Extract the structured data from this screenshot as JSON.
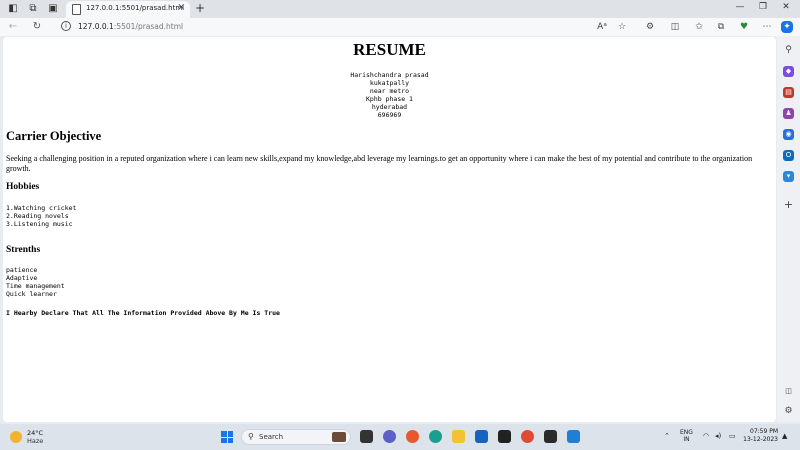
{
  "browser": {
    "tab_title": "127.0.0.1:5501/prasad.html",
    "tab_close": "✕",
    "new_tab": "+",
    "url_host": "127.0.0.1",
    "url_rest": ":5501/prasad.html",
    "window_controls": {
      "minimize": "—",
      "maximize": "❐",
      "close": "✕"
    }
  },
  "page": {
    "title": "RESUME",
    "address_lines": [
      "Harishchandra prasad",
      "kukatpally",
      "near metro",
      "Kphb phase 1",
      "hyderabad",
      "696969"
    ],
    "objective_heading": "Carrier Objective",
    "objective_text": "Seeking a challenging position in a reputed organization where i can learn new skills,expand my knowledge,abd leverage my learnings.to get an opportunity where i can make the best of my potential and contribute to the organization growth.",
    "hobbies_heading": "Hobbies",
    "hobbies": [
      "1.Watching cricket",
      "2.Reading novels",
      "3.Listening music"
    ],
    "strengths_heading": "Strenths",
    "strengths": [
      "patience",
      "Adaptive",
      "Time management",
      "Quick learner"
    ],
    "declaration": "I Hearby Declare That All The Information Provided Above By Me Is True"
  },
  "taskbar": {
    "temperature": "24°C",
    "condition": "Haze",
    "search_label": "Search",
    "language_line1": "ENG",
    "language_line2": "IN",
    "time": "07:59 PM",
    "date": "13-12-2023"
  },
  "colors": {
    "accent": "#1a73e8",
    "tab_bar": "#dfe3e7",
    "taskbar": "#dde3ea"
  }
}
